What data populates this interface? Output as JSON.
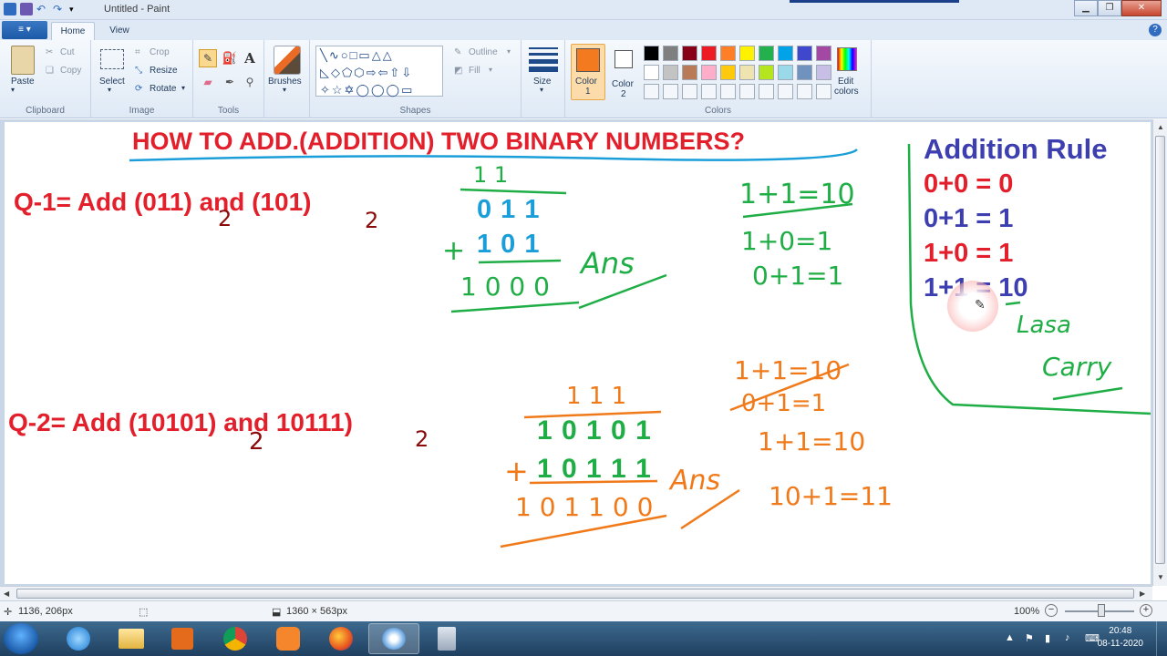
{
  "window": {
    "title": "Untitled - Paint"
  },
  "tabs": [
    {
      "label": "Home"
    },
    {
      "label": "View"
    }
  ],
  "ribbon": {
    "clipboard": {
      "paste": "Paste",
      "cut": "Cut",
      "copy": "Copy",
      "group": "Clipboard"
    },
    "image": {
      "select": "Select",
      "crop": "Crop",
      "resize": "Resize",
      "rotate": "Rotate",
      "group": "Image"
    },
    "tools": {
      "group": "Tools"
    },
    "brushes": {
      "label": "Brushes"
    },
    "shapes": {
      "outline": "Outline",
      "fill": "Fill",
      "group": "Shapes"
    },
    "size": {
      "label": "Size"
    },
    "colors": {
      "color1_label": "Color",
      "color1_num": "1",
      "color2_label": "Color",
      "color2_num": "2",
      "edit_label1": "Edit",
      "edit_label2": "colors",
      "group": "Colors",
      "color1": "#f47a20",
      "color2": "#ffffff",
      "palette_row1": [
        "#000000",
        "#7f7f7f",
        "#880015",
        "#ed1c24",
        "#ff7f27",
        "#fff200",
        "#22b14c",
        "#00a2e8",
        "#3f48cc",
        "#a349a4"
      ],
      "palette_row2": [
        "#ffffff",
        "#c3c3c3",
        "#b97a57",
        "#ffaec9",
        "#ffc90e",
        "#efe4b0",
        "#b5e61d",
        "#99d9ea",
        "#7092be",
        "#c8bfe7"
      ]
    }
  },
  "canvas": {
    "heading": "HOW TO ADD.(ADDITION) TWO BINARY NUMBERS?",
    "q1": "Q-1= Add (011) and (101)",
    "q1_sub_a": "2",
    "q1_sub_b": "2",
    "q2": "Q-2= Add (10101) and 10111)",
    "q2_sub_a": "2",
    "q2_sub_b": "2",
    "rule_title": "Addition Rule",
    "rules": [
      "0+0 = 0",
      "0+1 = 1",
      "1+0 = 1",
      "1+1 = 10"
    ],
    "ex1": {
      "carry": "1 1",
      "row1": "0 1 1",
      "plus": "+",
      "row2": "1 0 1",
      "result": "1 0 0 0",
      "ans": "Ans",
      "side": [
        "1+1=10",
        "1+0=1",
        "0+1=1"
      ]
    },
    "ex2": {
      "carry": "1 1 1",
      "row1": "1 0 1 0 1",
      "plus": "+",
      "row2": "1 0 1 1 1",
      "result": "1 0 1 1 0 0",
      "ans": "Ans",
      "side": [
        "1+1=10",
        "0+1=1",
        "1+1=10",
        "10+1=11"
      ]
    },
    "carry_note1": "Lasa",
    "carry_note2": "Carry"
  },
  "status": {
    "cursor": "1136, 206px",
    "canvas_size": "1360 × 563px",
    "zoom": "100%"
  },
  "taskbar": {
    "time": "20:48",
    "date": "08-11-2020"
  }
}
